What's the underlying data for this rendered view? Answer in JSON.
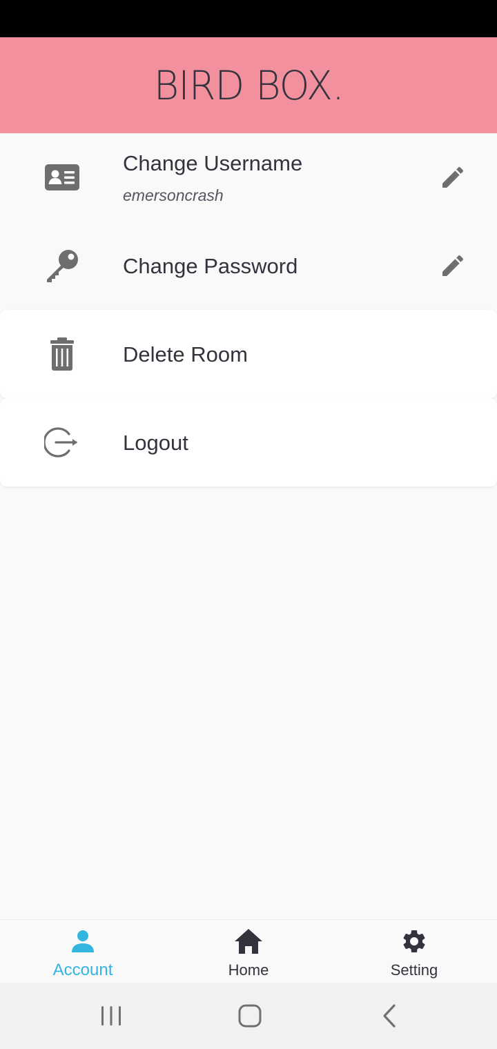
{
  "app": {
    "title": "BIRD BOX."
  },
  "colors": {
    "header_bg": "#f2909e",
    "accent": "#33b5e0",
    "icon_gray": "#6e6e6e",
    "text_dark": "#33333d"
  },
  "account_list": {
    "items": [
      {
        "label": "Change Username",
        "value": "emersoncrash",
        "icon": "id-card-icon",
        "action_icon": "pencil-edit-icon"
      },
      {
        "label": "Change Password",
        "icon": "key-icon",
        "action_icon": "pencil-edit-icon"
      },
      {
        "label": "Delete Room",
        "icon": "trash-icon"
      },
      {
        "label": "Logout",
        "icon": "logout-icon"
      }
    ]
  },
  "bottom_nav": {
    "items": [
      {
        "label": "Account",
        "icon": "person-icon",
        "active": true
      },
      {
        "label": "Home",
        "icon": "home-icon",
        "active": false
      },
      {
        "label": "Setting",
        "icon": "gear-icon",
        "active": false
      }
    ]
  },
  "system_nav": {
    "buttons": [
      "recent-apps-icon",
      "home-circle-icon",
      "back-icon"
    ]
  }
}
